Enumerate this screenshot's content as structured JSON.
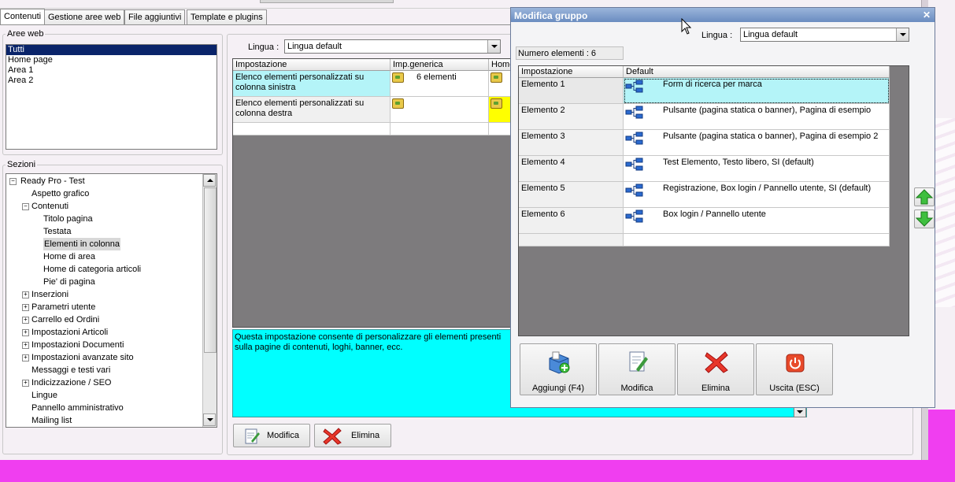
{
  "main_tabs": [
    {
      "label": "Contenuti"
    },
    {
      "label": "Gestione aree web"
    },
    {
      "label": "File aggiuntivi"
    },
    {
      "label": "Template e plugins"
    }
  ],
  "aree_web": {
    "title": "Aree web",
    "items": [
      "Tutti",
      "Home page",
      "Area 1",
      "Area 2"
    ],
    "selected": "Tutti"
  },
  "sezioni": {
    "title": "Sezioni",
    "tree": [
      {
        "label": "Ready Pro - Test",
        "level": 0,
        "expander": "minus"
      },
      {
        "label": "Aspetto grafico",
        "level": 1,
        "expander": ""
      },
      {
        "label": "Contenuti",
        "level": 1,
        "expander": "minus"
      },
      {
        "label": "Titolo pagina",
        "level": 2,
        "expander": ""
      },
      {
        "label": "Testata",
        "level": 2,
        "expander": ""
      },
      {
        "label": "Elementi in colonna",
        "level": 2,
        "expander": "",
        "selected": true
      },
      {
        "label": "Home di area",
        "level": 2,
        "expander": ""
      },
      {
        "label": "Home di categoria articoli",
        "level": 2,
        "expander": ""
      },
      {
        "label": "Pie' di pagina",
        "level": 2,
        "expander": ""
      },
      {
        "label": "Inserzioni",
        "level": 1,
        "expander": "plus"
      },
      {
        "label": "Parametri utente",
        "level": 1,
        "expander": "plus"
      },
      {
        "label": "Carrello ed Ordini",
        "level": 1,
        "expander": "plus"
      },
      {
        "label": "Impostazioni Articoli",
        "level": 1,
        "expander": "plus"
      },
      {
        "label": "Impostazioni Documenti",
        "level": 1,
        "expander": "plus"
      },
      {
        "label": "Impostazioni avanzate sito",
        "level": 1,
        "expander": "plus"
      },
      {
        "label": "Messaggi e testi vari",
        "level": 1,
        "expander": ""
      },
      {
        "label": "Indicizzazione / SEO",
        "level": 1,
        "expander": "plus"
      },
      {
        "label": "Lingue",
        "level": 1,
        "expander": ""
      },
      {
        "label": "Pannello amministrativo",
        "level": 1,
        "expander": ""
      },
      {
        "label": "Mailing list",
        "level": 1,
        "expander": ""
      }
    ]
  },
  "center": {
    "lingua_label": "Lingua :",
    "lingua_value": "Lingua default",
    "columns": [
      "Impostazione",
      "Imp.generica",
      "Home"
    ],
    "rows": [
      {
        "impostazione": "Elenco elementi personalizzati su colonna sinistra",
        "generica": "6 elementi"
      },
      {
        "impostazione": "Elenco elementi personalizzati su colonna destra",
        "generica": ""
      }
    ],
    "description": "Questa impostazione consente di personalizzare gli elementi presenti sulla pagine di contenuti, loghi, banner, ecc.",
    "modifica_label": "Modifica",
    "elimina_label": "Elimina"
  },
  "dialog": {
    "title": "Modifica gruppo",
    "lingua_label": "Lingua :",
    "lingua_value": "Lingua default",
    "count_label": "Numero elementi : 6",
    "columns": [
      "Impostazione",
      "Default"
    ],
    "rows": [
      {
        "name": "Elemento 1",
        "value": "Form di ricerca per marca"
      },
      {
        "name": "Elemento 2",
        "value": "Pulsante (pagina statica o banner), Pagina di esempio"
      },
      {
        "name": "Elemento 3",
        "value": "Pulsante (pagina statica o banner), Pagina di esempio 2"
      },
      {
        "name": "Elemento 4",
        "value": "Test Elemento, Testo libero, SI (default)"
      },
      {
        "name": "Elemento 5",
        "value": "Registrazione, Box login / Pannello utente, SI (default)"
      },
      {
        "name": "Elemento 6",
        "value": "Box login / Pannello utente"
      }
    ],
    "buttons": [
      {
        "label": "Aggiungi (F4)",
        "icon": "add-box-icon"
      },
      {
        "label": "Modifica",
        "icon": "edit-document-icon"
      },
      {
        "label": "Elimina",
        "icon": "red-x-icon"
      },
      {
        "label": "Uscita (ESC)",
        "icon": "power-icon"
      }
    ],
    "close_glyph": "✕"
  },
  "colors": {
    "cyan_highlight": "#b4f4f8",
    "description_bg": "#00ffff",
    "selection_blue": "#0a246a",
    "title_bar": "#7c9cc8",
    "yellow_cell": "#ffff00",
    "magenta_background": "#f040f0"
  }
}
